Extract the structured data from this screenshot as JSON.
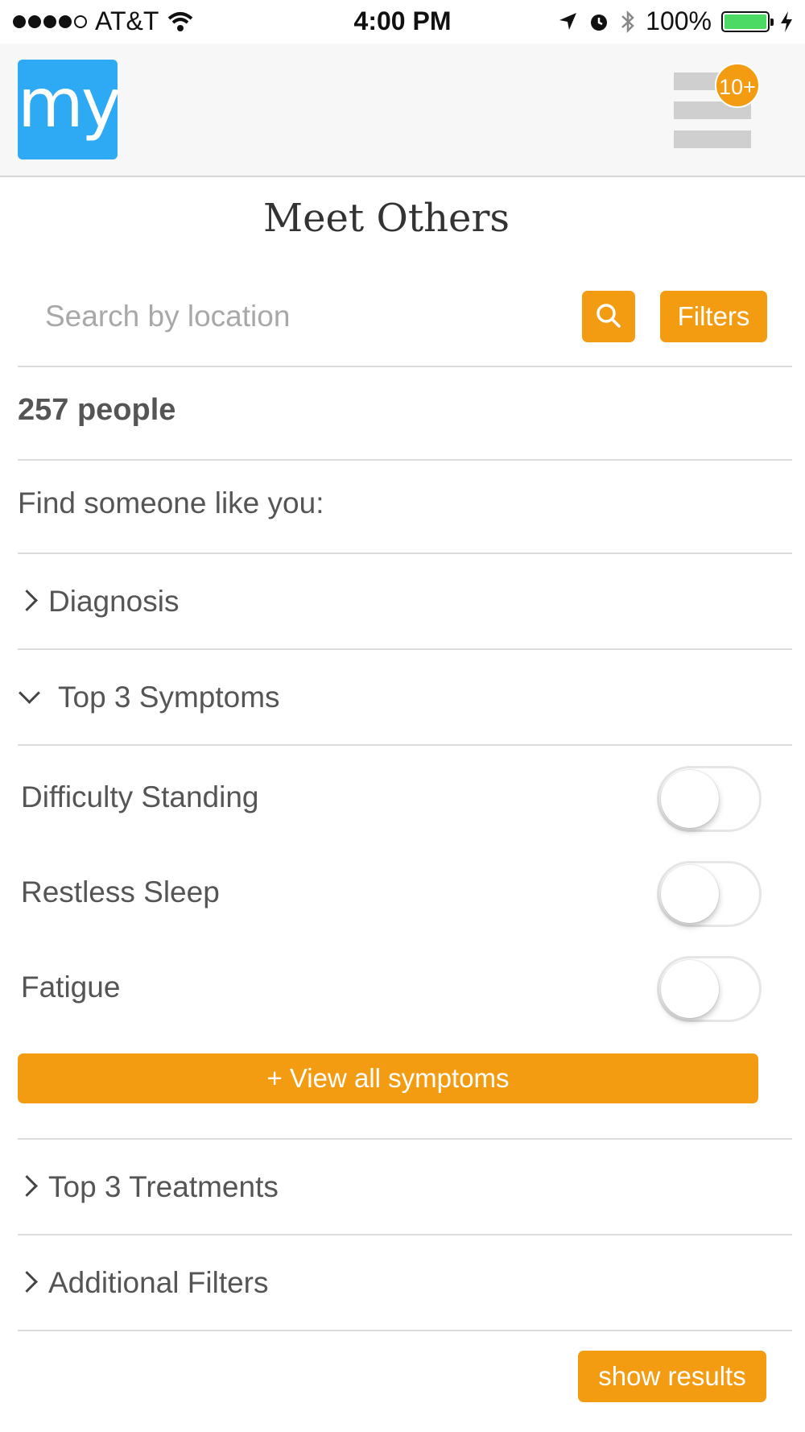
{
  "status_bar": {
    "carrier": "AT&T",
    "time": "4:00 PM",
    "battery": "100%"
  },
  "header": {
    "logo_text": "my",
    "notification_badge": "10+"
  },
  "page": {
    "title": "Meet Others"
  },
  "search": {
    "placeholder": "Search by location",
    "value": "",
    "filters_label": "Filters"
  },
  "results": {
    "people_count": "257 people",
    "find_label": "Find someone like you:"
  },
  "sections": {
    "diagnosis": "Diagnosis",
    "top_symptoms": "Top 3 Symptoms",
    "top_treatments": "Top 3 Treatments",
    "additional_filters": "Additional Filters"
  },
  "symptoms": [
    {
      "label": "Difficulty Standing",
      "enabled": false
    },
    {
      "label": "Restless Sleep",
      "enabled": false
    },
    {
      "label": "Fatigue",
      "enabled": false
    }
  ],
  "buttons": {
    "view_all_symptoms": "+ View all symptoms",
    "show_results": "show results"
  },
  "colors": {
    "accent": "#f39c12",
    "logo": "#2eaaf5",
    "battery": "#4cd964"
  }
}
